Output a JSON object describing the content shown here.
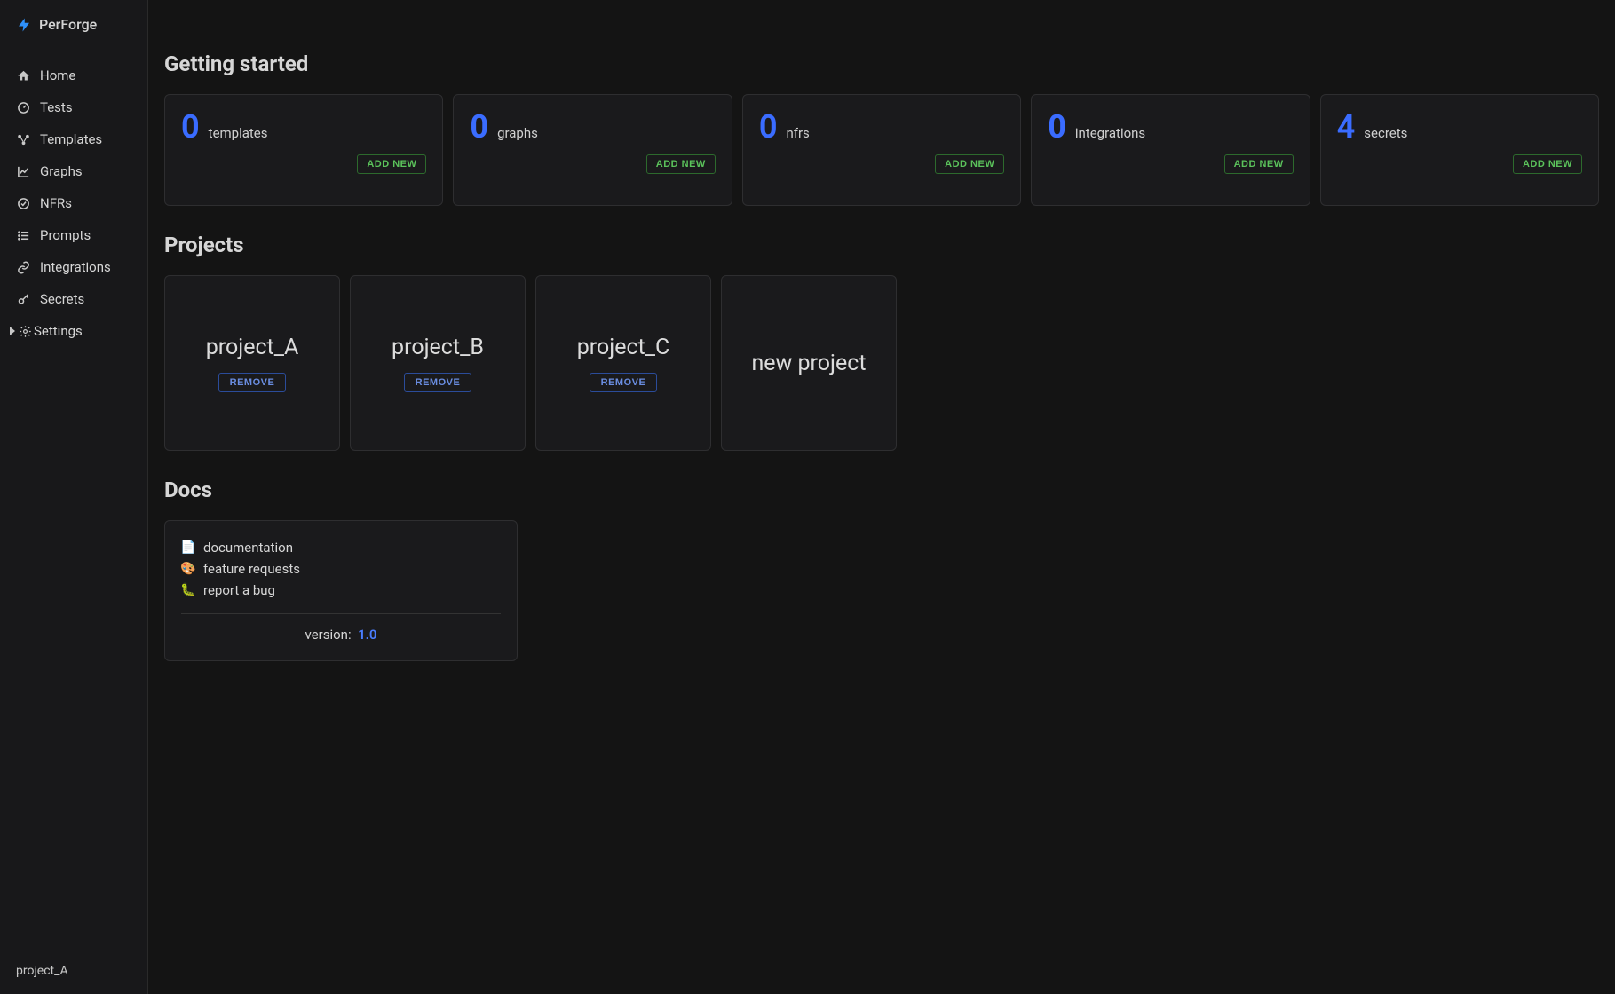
{
  "brand": {
    "name": "PerForge"
  },
  "sidebar": {
    "items": [
      {
        "label": "Home",
        "icon": "home"
      },
      {
        "label": "Tests",
        "icon": "gauge"
      },
      {
        "label": "Templates",
        "icon": "nodes"
      },
      {
        "label": "Graphs",
        "icon": "chart"
      },
      {
        "label": "NFRs",
        "icon": "check-circle"
      },
      {
        "label": "Prompts",
        "icon": "list"
      },
      {
        "label": "Integrations",
        "icon": "link"
      },
      {
        "label": "Secrets",
        "icon": "key"
      },
      {
        "label": "Settings",
        "icon": "gear",
        "caret": true
      }
    ],
    "footer": "project_A"
  },
  "sections": {
    "getting_started": "Getting started",
    "projects": "Projects",
    "docs": "Docs"
  },
  "stats": [
    {
      "count": "0",
      "label": "templates",
      "action": "ADD NEW"
    },
    {
      "count": "0",
      "label": "graphs",
      "action": "ADD NEW"
    },
    {
      "count": "0",
      "label": "nfrs",
      "action": "ADD NEW"
    },
    {
      "count": "0",
      "label": "integrations",
      "action": "ADD NEW"
    },
    {
      "count": "4",
      "label": "secrets",
      "action": "ADD NEW"
    }
  ],
  "projects": [
    {
      "name": "project_A",
      "action": "REMOVE"
    },
    {
      "name": "project_B",
      "action": "REMOVE"
    },
    {
      "name": "project_C",
      "action": "REMOVE"
    }
  ],
  "new_project": {
    "label": "new project"
  },
  "docs": {
    "links": [
      {
        "label": "documentation",
        "emoji": "📄"
      },
      {
        "label": "feature requests",
        "emoji": "🎨"
      },
      {
        "label": "report a bug",
        "emoji": "🐛"
      }
    ],
    "version_label": "version:",
    "version_value": "1.0"
  },
  "colors": {
    "accent_blue": "#3a6cff",
    "accent_green": "#5bc25b",
    "card_bg": "#1a1a1c"
  }
}
